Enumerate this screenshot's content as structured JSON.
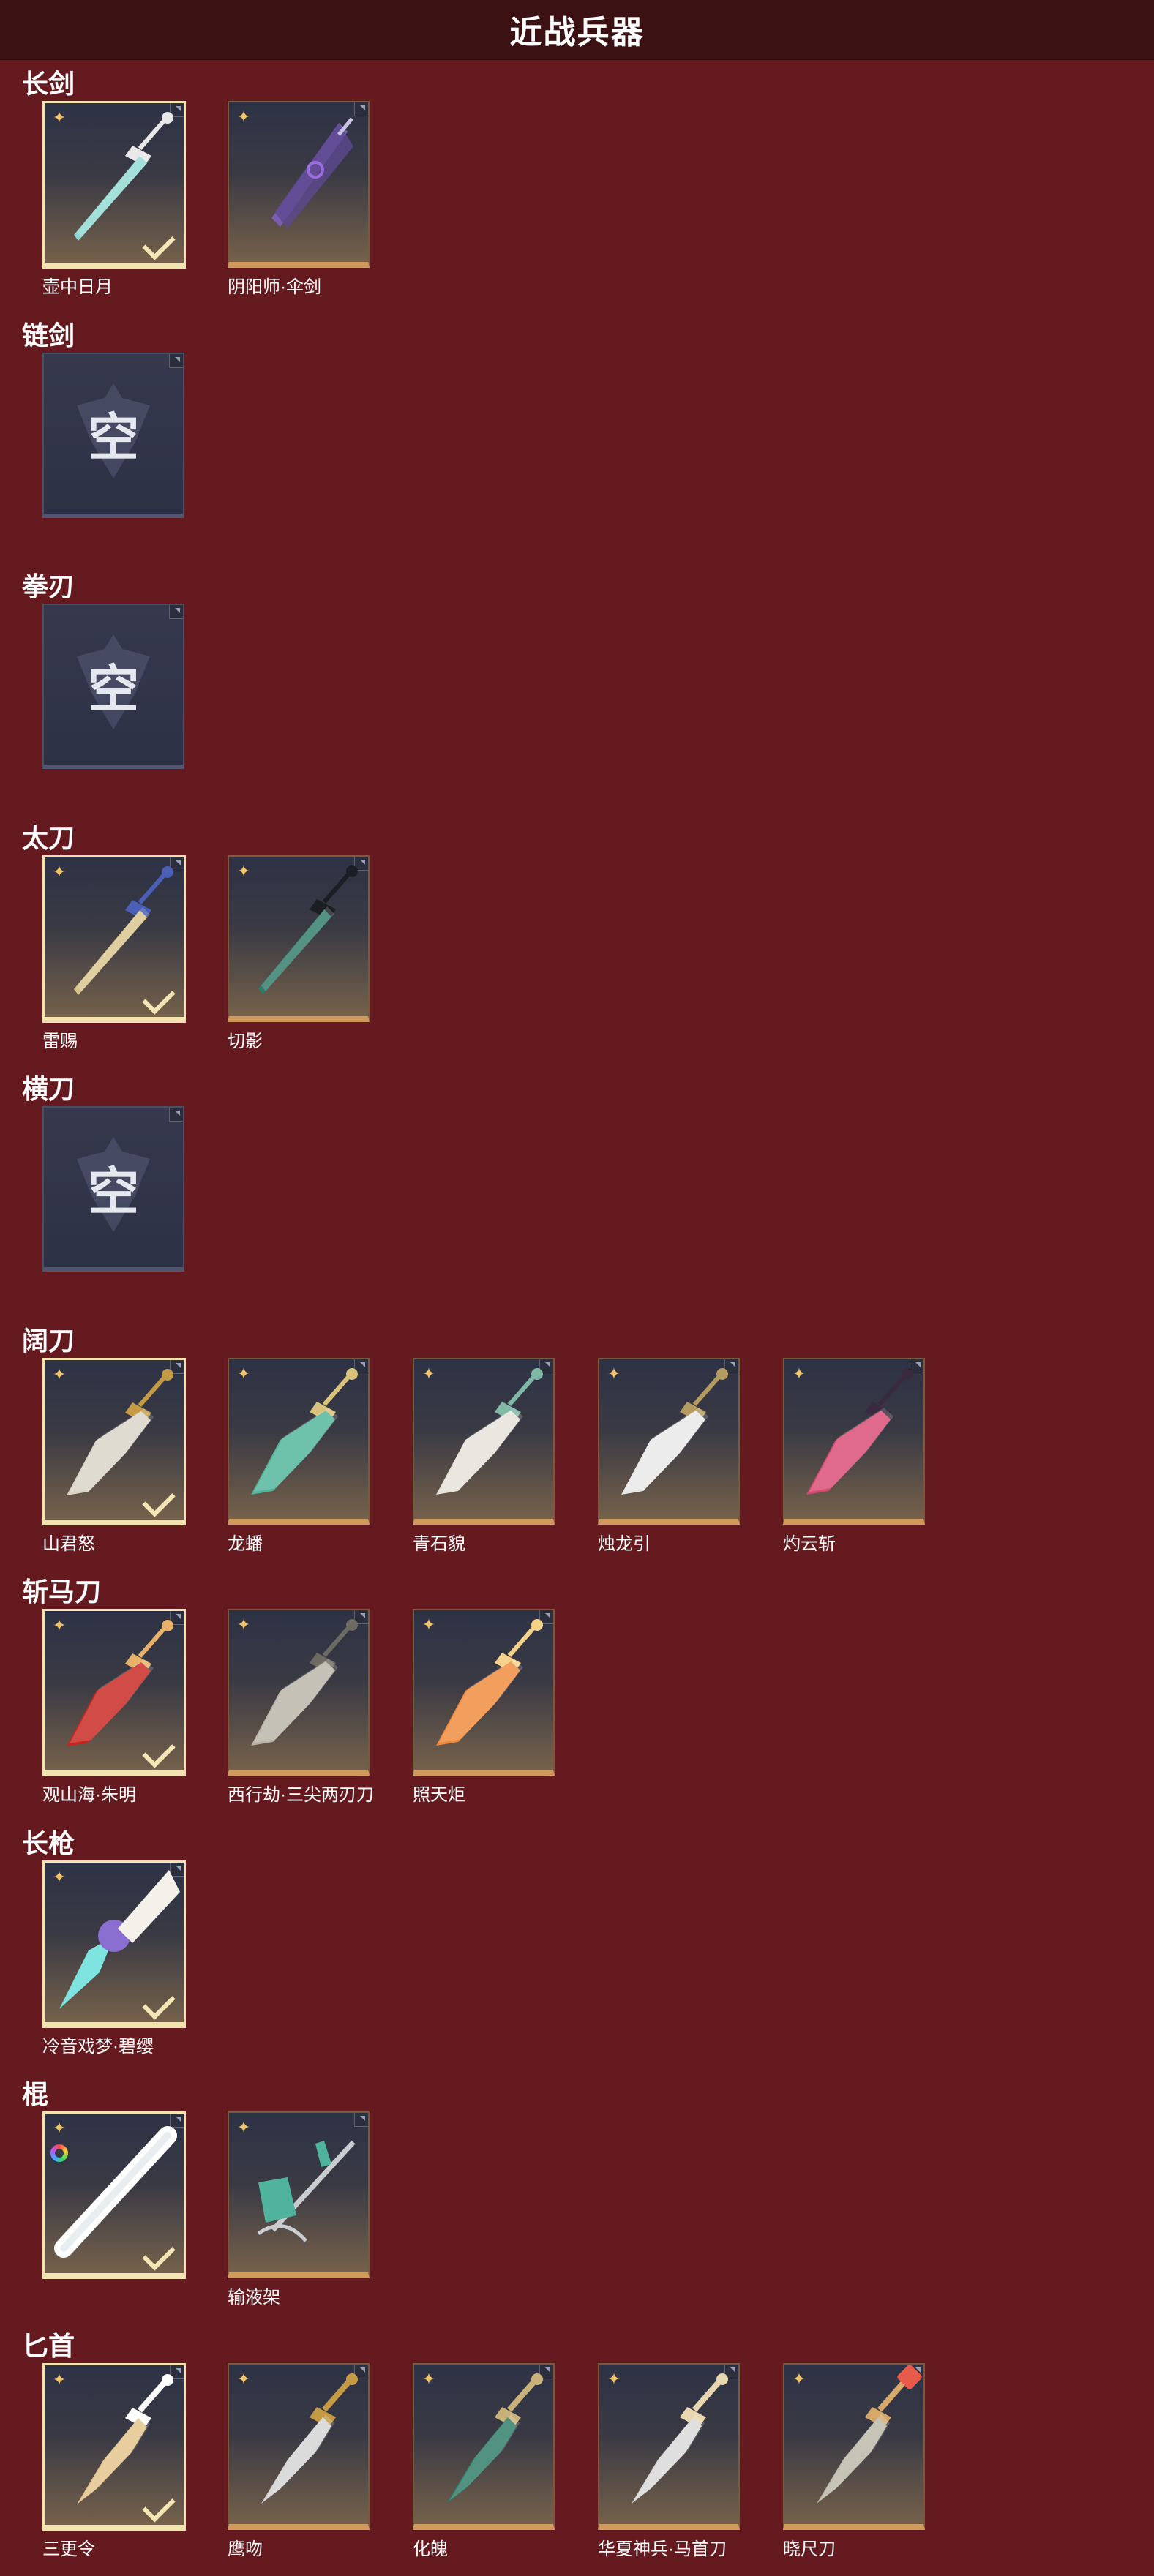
{
  "page": {
    "title": "近战兵器",
    "empty_text": "空"
  },
  "colors": {
    "background": "#651a1f",
    "header": "#3b1114",
    "rank": "#f2c56a",
    "selected_border": "#f3e3b0",
    "check": "#f6e6b5"
  },
  "categories": [
    {
      "name": "长剑",
      "weapons": [
        {
          "name": "壶中日月",
          "selected": true,
          "art": "crystal-sword",
          "blade": "#8fd9d2",
          "accent": "#e8e8e8"
        },
        {
          "name": "阴阳师·伞剑",
          "selected": false,
          "art": "umbrella-sword",
          "blade": "#7a5fb0",
          "accent": "#c9c3e3"
        }
      ]
    },
    {
      "name": "链剑",
      "weapons": []
    },
    {
      "name": "拳刃",
      "weapons": []
    },
    {
      "name": "太刀",
      "weapons": [
        {
          "name": "雷赐",
          "selected": true,
          "art": "ornate-tachi",
          "blade": "#d8c48a",
          "accent": "#4a5fb5"
        },
        {
          "name": "切影",
          "selected": false,
          "art": "shadow-tachi",
          "blade": "#2f7a68",
          "accent": "#1a1f24"
        }
      ]
    },
    {
      "name": "横刀",
      "weapons": []
    },
    {
      "name": "阔刀",
      "weapons": [
        {
          "name": "山君怒",
          "selected": true,
          "art": "tiger-blade",
          "blade": "#d9d3c6",
          "accent": "#c49a44"
        },
        {
          "name": "龙蟠",
          "selected": false,
          "art": "dragon-blade",
          "blade": "#4fb59a",
          "accent": "#d9c27a"
        },
        {
          "name": "青石貌",
          "selected": false,
          "art": "stone-blade",
          "blade": "#e6e2da",
          "accent": "#7fb8a4"
        },
        {
          "name": "烛龙引",
          "selected": false,
          "art": "candle-blade",
          "blade": "#e8e8e8",
          "accent": "#b59a60"
        },
        {
          "name": "灼云斩",
          "selected": false,
          "art": "flame-blade",
          "blade": "#d94a72",
          "accent": "#3a2a40"
        }
      ]
    },
    {
      "name": "斩马刀",
      "weapons": [
        {
          "name": "观山海·朱明",
          "selected": true,
          "art": "crimson-glaive",
          "blade": "#c8251f",
          "accent": "#e7b16a"
        },
        {
          "name": "西行劫·三尖两刃刀",
          "selected": false,
          "art": "trident-glaive",
          "blade": "#b9b4a6",
          "accent": "#6d6a62"
        },
        {
          "name": "照天炬",
          "selected": false,
          "art": "fire-glaive",
          "blade": "#f08a3a",
          "accent": "#f6d18a"
        }
      ]
    },
    {
      "name": "长枪",
      "weapons": [
        {
          "name": "冷音戏梦·碧缨",
          "selected": true,
          "art": "jade-spear",
          "blade": "#7fe3e0",
          "accent": "#8a6fd0"
        }
      ]
    },
    {
      "name": "棍",
      "weapons": [
        {
          "name": "",
          "selected": true,
          "art": "light-staff",
          "blade": "#ffffff",
          "accent": "#dfe6ea",
          "rainbow": true
        },
        {
          "name": "输液架",
          "selected": false,
          "art": "iv-stand",
          "blade": "#4fb39d",
          "accent": "#c9ccd0"
        }
      ]
    },
    {
      "name": "匕首",
      "weapons": [
        {
          "name": "三更令",
          "selected": true,
          "art": "gold-dagger",
          "blade": "#e3c28a",
          "accent": "#ffffff"
        },
        {
          "name": "鹰吻",
          "selected": false,
          "art": "eagle-dagger",
          "blade": "#d4d4d4",
          "accent": "#c49a44"
        },
        {
          "name": "化魄",
          "selected": false,
          "art": "jade-dagger",
          "blade": "#2d7a64",
          "accent": "#c8b27a"
        },
        {
          "name": "华夏神兵·马首刀",
          "selected": false,
          "art": "horse-dagger",
          "blade": "#d8d8d8",
          "accent": "#e8d6b0"
        },
        {
          "name": "晓尺刀",
          "selected": false,
          "art": "dawn-dagger",
          "blade": "#bab6a8",
          "accent": "#d6a86a",
          "badge": true
        }
      ]
    }
  ]
}
